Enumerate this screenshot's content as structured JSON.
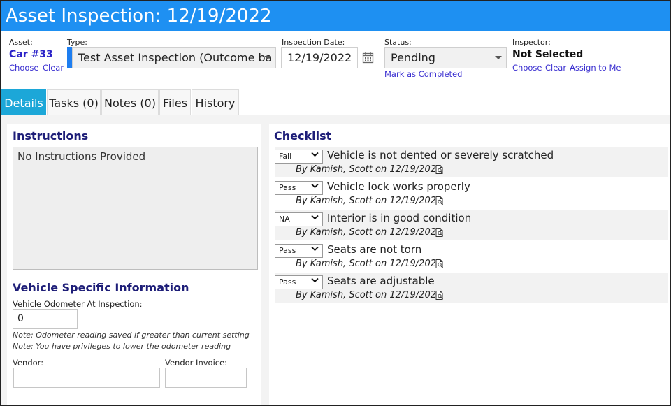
{
  "title": "Asset Inspection: 12/19/2022",
  "header": {
    "asset_label": "Asset:",
    "asset_value": "Car #33",
    "asset_choose": "Choose",
    "asset_clear": "Clear",
    "type_label": "Type:",
    "type_value": "Test Asset Inspection (Outcome ba",
    "date_label": "Inspection Date:",
    "date_value": "12/19/2022",
    "status_label": "Status:",
    "status_value": "Pending",
    "status_link": "Mark as Completed",
    "inspector_label": "Inspector:",
    "inspector_value": "Not Selected",
    "inspector_choose": "Choose",
    "inspector_clear": "Clear",
    "inspector_assign": "Assign to Me"
  },
  "tabs": [
    {
      "label": "Details"
    },
    {
      "label": "Tasks (0)"
    },
    {
      "label": "Notes (0)"
    },
    {
      "label": "Files"
    },
    {
      "label": "History"
    }
  ],
  "left": {
    "instructions_title": "Instructions",
    "instructions_text": "No Instructions Provided",
    "vehicle_title": "Vehicle Specific Information",
    "odometer_label": "Vehicle Odometer At Inspection:",
    "odometer_value": "0",
    "note1": "Note: Odometer reading saved if greater than current setting",
    "note2": "Note: You have privileges to lower the odometer reading",
    "vendor_label": "Vendor:",
    "vendor_value": "",
    "vendor_invoice_label": "Vendor Invoice:",
    "vendor_invoice_value": ""
  },
  "checklist": {
    "title": "Checklist",
    "items": [
      {
        "result": "Fail",
        "text": "Vehicle is not dented or severely scratched",
        "by": "By Kamish, Scott on 12/19/2022"
      },
      {
        "result": "Pass",
        "text": "Vehicle lock works properly",
        "by": "By Kamish, Scott on 12/19/2022"
      },
      {
        "result": "NA",
        "text": "Interior is in good condition",
        "by": "By Kamish, Scott on 12/19/2022"
      },
      {
        "result": "Pass",
        "text": "Seats are not torn",
        "by": "By Kamish, Scott on 12/19/2022"
      },
      {
        "result": "Pass",
        "text": "Seats are adjustable",
        "by": "By Kamish, Scott on 12/19/2022"
      }
    ]
  },
  "colors": {
    "titlebar": "#1e90f2",
    "tab_active": "#1ca7d8",
    "link": "#3a2fd0",
    "heading": "#1e1e78"
  }
}
